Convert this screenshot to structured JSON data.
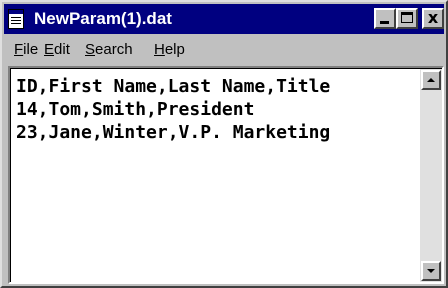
{
  "window": {
    "title": "NewParam(1).dat",
    "title_bar_color": "#000080"
  },
  "title_buttons": {
    "minimize_icon": "minimize-icon",
    "maximize_icon": "maximize-icon",
    "close_glyph": "x"
  },
  "menu": {
    "items": [
      {
        "mnemonic": "F",
        "rest": "ile"
      },
      {
        "mnemonic": "E",
        "rest": "dit"
      },
      {
        "mnemonic": "S",
        "rest": "earch"
      },
      {
        "mnemonic": "H",
        "rest": "elp"
      }
    ]
  },
  "editor": {
    "lines": [
      "ID,First Name,Last Name,Title",
      "14,Tom,Smith,President",
      "23,Jane,Winter,V.P. Marketing"
    ]
  }
}
